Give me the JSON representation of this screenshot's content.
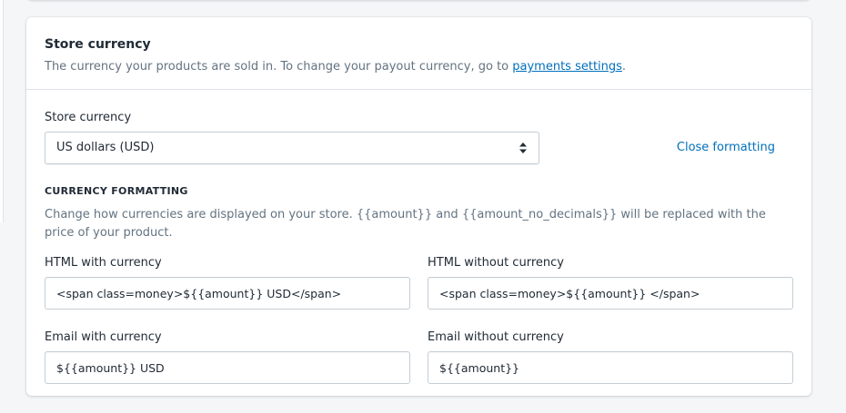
{
  "card": {
    "title": "Store currency",
    "description_prefix": "The currency your products are sold in. To change your payout currency, go to ",
    "description_link": "payments settings",
    "description_suffix": "."
  },
  "store_currency": {
    "label": "Store currency",
    "selected": "US dollars (USD)",
    "close_formatting": "Close formatting"
  },
  "formatting": {
    "heading": "CURRENCY FORMATTING",
    "help": "Change how currencies are displayed on your store. {{amount}} and {{amount_no_decimals}} will be replaced with the price of your product.",
    "html_with_currency": {
      "label": "HTML with currency",
      "value": "<span class=money>${{amount}} USD</span>"
    },
    "html_without_currency": {
      "label": "HTML without currency",
      "value": "<span class=money>${{amount}} </span>"
    },
    "email_with_currency": {
      "label": "Email with currency",
      "value": "${{amount}} USD"
    },
    "email_without_currency": {
      "label": "Email without currency",
      "value": "${{amount}}"
    }
  },
  "colors": {
    "link": "#006fbb",
    "text": "#212b36",
    "subdued": "#637381",
    "border": "#c4cdd5",
    "background": "#f4f6f8"
  }
}
